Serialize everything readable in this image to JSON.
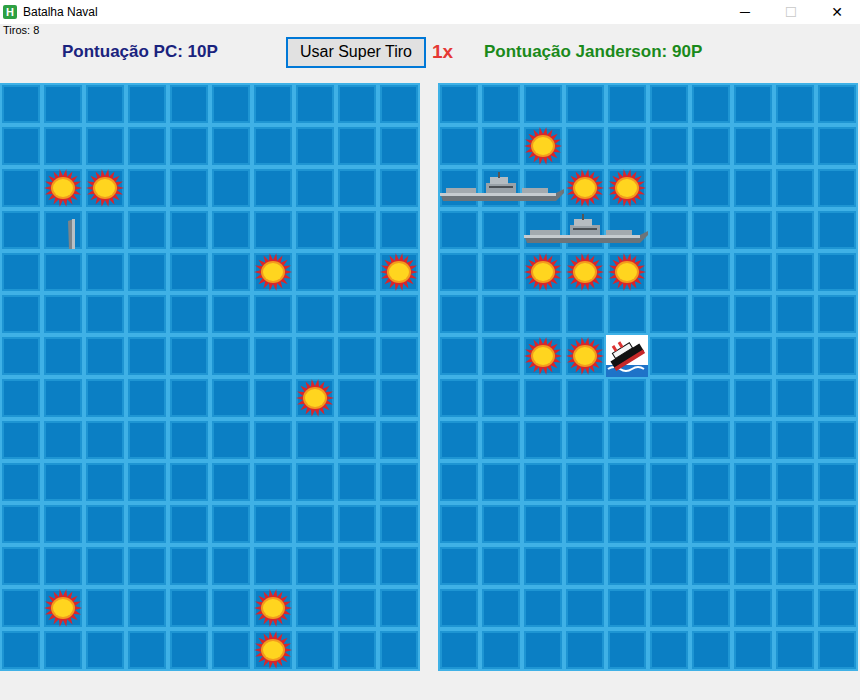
{
  "window": {
    "title": "Batalha Naval",
    "icon_text": "H",
    "controls": [
      {
        "label": "─",
        "disabled": false
      },
      {
        "label": "☐",
        "disabled": true
      },
      {
        "label": "✕",
        "disabled": false
      }
    ]
  },
  "shots": "Tiros: 8",
  "score_pc": "Pontuação PC: 10P",
  "super_shot_button": "Usar Super Tiro",
  "super_shot_count": "1x",
  "score_player": "Pontuação Janderson: 90P",
  "boards": [
    {
      "rows": [
        [
          {
            "kind": "water"
          },
          {
            "kind": "water"
          },
          {
            "kind": "water"
          },
          {
            "kind": "water"
          },
          {
            "kind": "water"
          },
          {
            "kind": "water"
          },
          {
            "kind": "water"
          },
          {
            "kind": "water"
          },
          {
            "kind": "water"
          },
          {
            "kind": "water"
          }
        ],
        [
          {
            "kind": "water"
          },
          {
            "kind": "water"
          },
          {
            "kind": "water"
          },
          {
            "kind": "water"
          },
          {
            "kind": "water"
          },
          {
            "kind": "water"
          },
          {
            "kind": "water"
          },
          {
            "kind": "water"
          },
          {
            "kind": "water"
          },
          {
            "kind": "water"
          }
        ],
        [
          {
            "kind": "water"
          },
          {
            "kind": "hit"
          },
          {
            "kind": "hit"
          },
          {
            "kind": "water"
          },
          {
            "kind": "water"
          },
          {
            "kind": "water"
          },
          {
            "kind": "water"
          },
          {
            "kind": "water"
          },
          {
            "kind": "water"
          },
          {
            "kind": "water"
          }
        ],
        [
          {
            "kind": "water"
          },
          {
            "kind": "fragment"
          },
          {
            "kind": "water"
          },
          {
            "kind": "water"
          },
          {
            "kind": "water"
          },
          {
            "kind": "water"
          },
          {
            "kind": "water"
          },
          {
            "kind": "water"
          },
          {
            "kind": "water"
          },
          {
            "kind": "water"
          }
        ],
        [
          {
            "kind": "water"
          },
          {
            "kind": "water"
          },
          {
            "kind": "water"
          },
          {
            "kind": "water"
          },
          {
            "kind": "water"
          },
          {
            "kind": "water"
          },
          {
            "kind": "hit"
          },
          {
            "kind": "water"
          },
          {
            "kind": "water"
          },
          {
            "kind": "hit"
          }
        ],
        [
          {
            "kind": "water"
          },
          {
            "kind": "water"
          },
          {
            "kind": "water"
          },
          {
            "kind": "water"
          },
          {
            "kind": "water"
          },
          {
            "kind": "water"
          },
          {
            "kind": "water"
          },
          {
            "kind": "water"
          },
          {
            "kind": "water"
          },
          {
            "kind": "water"
          }
        ],
        [
          {
            "kind": "water"
          },
          {
            "kind": "water"
          },
          {
            "kind": "water"
          },
          {
            "kind": "water"
          },
          {
            "kind": "water"
          },
          {
            "kind": "water"
          },
          {
            "kind": "water"
          },
          {
            "kind": "water"
          },
          {
            "kind": "water"
          },
          {
            "kind": "water"
          }
        ],
        [
          {
            "kind": "water"
          },
          {
            "kind": "water"
          },
          {
            "kind": "water"
          },
          {
            "kind": "water"
          },
          {
            "kind": "water"
          },
          {
            "kind": "water"
          },
          {
            "kind": "water"
          },
          {
            "kind": "hit"
          },
          {
            "kind": "water"
          },
          {
            "kind": "water"
          }
        ],
        [
          {
            "kind": "water"
          },
          {
            "kind": "water"
          },
          {
            "kind": "water"
          },
          {
            "kind": "water"
          },
          {
            "kind": "water"
          },
          {
            "kind": "water"
          },
          {
            "kind": "water"
          },
          {
            "kind": "water"
          },
          {
            "kind": "water"
          },
          {
            "kind": "water"
          }
        ],
        [
          {
            "kind": "water"
          },
          {
            "kind": "water"
          },
          {
            "kind": "water"
          },
          {
            "kind": "water"
          },
          {
            "kind": "water"
          },
          {
            "kind": "water"
          },
          {
            "kind": "water"
          },
          {
            "kind": "water"
          },
          {
            "kind": "water"
          },
          {
            "kind": "water"
          }
        ],
        [
          {
            "kind": "water"
          },
          {
            "kind": "water"
          },
          {
            "kind": "water"
          },
          {
            "kind": "water"
          },
          {
            "kind": "water"
          },
          {
            "kind": "water"
          },
          {
            "kind": "water"
          },
          {
            "kind": "water"
          },
          {
            "kind": "water"
          },
          {
            "kind": "water"
          }
        ],
        [
          {
            "kind": "water"
          },
          {
            "kind": "water"
          },
          {
            "kind": "water"
          },
          {
            "kind": "water"
          },
          {
            "kind": "water"
          },
          {
            "kind": "water"
          },
          {
            "kind": "water"
          },
          {
            "kind": "water"
          },
          {
            "kind": "water"
          },
          {
            "kind": "water"
          }
        ],
        [
          {
            "kind": "water"
          },
          {
            "kind": "hit"
          },
          {
            "kind": "water"
          },
          {
            "kind": "water"
          },
          {
            "kind": "water"
          },
          {
            "kind": "water"
          },
          {
            "kind": "hit"
          },
          {
            "kind": "water"
          },
          {
            "kind": "water"
          },
          {
            "kind": "water"
          }
        ],
        [
          {
            "kind": "water"
          },
          {
            "kind": "water"
          },
          {
            "kind": "water"
          },
          {
            "kind": "water"
          },
          {
            "kind": "water"
          },
          {
            "kind": "water"
          },
          {
            "kind": "hit"
          },
          {
            "kind": "water"
          },
          {
            "kind": "water"
          },
          {
            "kind": "water"
          }
        ]
      ]
    },
    {
      "rows": [
        [
          {
            "kind": "water"
          },
          {
            "kind": "water"
          },
          {
            "kind": "water"
          },
          {
            "kind": "water"
          },
          {
            "kind": "water"
          },
          {
            "kind": "water"
          },
          {
            "kind": "water"
          },
          {
            "kind": "water"
          },
          {
            "kind": "water"
          },
          {
            "kind": "water"
          }
        ],
        [
          {
            "kind": "water"
          },
          {
            "kind": "water"
          },
          {
            "kind": "hit"
          },
          {
            "kind": "water"
          },
          {
            "kind": "water"
          },
          {
            "kind": "water"
          },
          {
            "kind": "water"
          },
          {
            "kind": "water"
          },
          {
            "kind": "water"
          },
          {
            "kind": "water"
          }
        ],
        [
          {
            "kind": "ship"
          },
          {
            "kind": "ship"
          },
          {
            "kind": "ship"
          },
          {
            "kind": "hit"
          },
          {
            "kind": "hit"
          },
          {
            "kind": "water"
          },
          {
            "kind": "water"
          },
          {
            "kind": "water"
          },
          {
            "kind": "water"
          },
          {
            "kind": "water"
          }
        ],
        [
          {
            "kind": "water"
          },
          {
            "kind": "water"
          },
          {
            "kind": "ship"
          },
          {
            "kind": "ship"
          },
          {
            "kind": "ship"
          },
          {
            "kind": "water"
          },
          {
            "kind": "water"
          },
          {
            "kind": "water"
          },
          {
            "kind": "water"
          },
          {
            "kind": "water"
          }
        ],
        [
          {
            "kind": "water"
          },
          {
            "kind": "water"
          },
          {
            "kind": "hit"
          },
          {
            "kind": "hit"
          },
          {
            "kind": "hit"
          },
          {
            "kind": "water"
          },
          {
            "kind": "water"
          },
          {
            "kind": "water"
          },
          {
            "kind": "water"
          },
          {
            "kind": "water"
          }
        ],
        [
          {
            "kind": "water"
          },
          {
            "kind": "water"
          },
          {
            "kind": "water"
          },
          {
            "kind": "water"
          },
          {
            "kind": "water"
          },
          {
            "kind": "water"
          },
          {
            "kind": "water"
          },
          {
            "kind": "water"
          },
          {
            "kind": "water"
          },
          {
            "kind": "water"
          }
        ],
        [
          {
            "kind": "water"
          },
          {
            "kind": "water"
          },
          {
            "kind": "hit"
          },
          {
            "kind": "hit"
          },
          {
            "kind": "sunk"
          },
          {
            "kind": "water"
          },
          {
            "kind": "water"
          },
          {
            "kind": "water"
          },
          {
            "kind": "water"
          },
          {
            "kind": "water"
          }
        ],
        [
          {
            "kind": "water"
          },
          {
            "kind": "water"
          },
          {
            "kind": "water"
          },
          {
            "kind": "water"
          },
          {
            "kind": "water"
          },
          {
            "kind": "water"
          },
          {
            "kind": "water"
          },
          {
            "kind": "water"
          },
          {
            "kind": "water"
          },
          {
            "kind": "water"
          }
        ],
        [
          {
            "kind": "water"
          },
          {
            "kind": "water"
          },
          {
            "kind": "water"
          },
          {
            "kind": "water"
          },
          {
            "kind": "water"
          },
          {
            "kind": "water"
          },
          {
            "kind": "water"
          },
          {
            "kind": "water"
          },
          {
            "kind": "water"
          },
          {
            "kind": "water"
          }
        ],
        [
          {
            "kind": "water"
          },
          {
            "kind": "water"
          },
          {
            "kind": "water"
          },
          {
            "kind": "water"
          },
          {
            "kind": "water"
          },
          {
            "kind": "water"
          },
          {
            "kind": "water"
          },
          {
            "kind": "water"
          },
          {
            "kind": "water"
          },
          {
            "kind": "water"
          }
        ],
        [
          {
            "kind": "water"
          },
          {
            "kind": "water"
          },
          {
            "kind": "water"
          },
          {
            "kind": "water"
          },
          {
            "kind": "water"
          },
          {
            "kind": "water"
          },
          {
            "kind": "water"
          },
          {
            "kind": "water"
          },
          {
            "kind": "water"
          },
          {
            "kind": "water"
          }
        ],
        [
          {
            "kind": "water"
          },
          {
            "kind": "water"
          },
          {
            "kind": "water"
          },
          {
            "kind": "water"
          },
          {
            "kind": "water"
          },
          {
            "kind": "water"
          },
          {
            "kind": "water"
          },
          {
            "kind": "water"
          },
          {
            "kind": "water"
          },
          {
            "kind": "water"
          }
        ],
        [
          {
            "kind": "water"
          },
          {
            "kind": "water"
          },
          {
            "kind": "water"
          },
          {
            "kind": "water"
          },
          {
            "kind": "water"
          },
          {
            "kind": "water"
          },
          {
            "kind": "water"
          },
          {
            "kind": "water"
          },
          {
            "kind": "water"
          },
          {
            "kind": "water"
          }
        ],
        [
          {
            "kind": "water"
          },
          {
            "kind": "water"
          },
          {
            "kind": "water"
          },
          {
            "kind": "water"
          },
          {
            "kind": "water"
          },
          {
            "kind": "water"
          },
          {
            "kind": "water"
          },
          {
            "kind": "water"
          },
          {
            "kind": "water"
          },
          {
            "kind": "water"
          }
        ]
      ]
    }
  ]
}
